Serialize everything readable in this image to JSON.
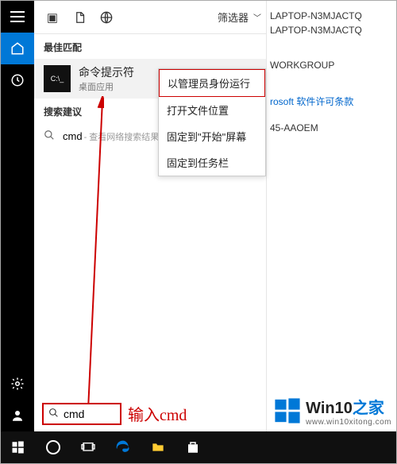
{
  "rail": {
    "items": [
      "menu",
      "home",
      "clock",
      "gear",
      "people"
    ]
  },
  "panel_top": {
    "filter_label": "筛选器"
  },
  "sections": {
    "best_match": "最佳匹配",
    "suggestions": "搜索建议"
  },
  "result": {
    "title": "命令提示符",
    "subtitle": "桌面应用",
    "thumb_text": "C:\\_"
  },
  "suggest": {
    "query": "cmd",
    "hint": "- 查看网络搜索结果"
  },
  "context_menu": {
    "items": [
      "以管理员身份运行",
      "打开文件位置",
      "固定到\"开始\"屏幕",
      "固定到任务栏"
    ],
    "highlight_index": 0
  },
  "background": {
    "line1": "LAPTOP-N3MJACTQ",
    "line2": "LAPTOP-N3MJACTQ",
    "line3": "WORKGROUP",
    "link": "rosoft 软件许可条款",
    "line4": "45-AAOEM"
  },
  "search": {
    "value": "cmd",
    "annotation": "输入cmd"
  },
  "watermark": {
    "brand1": "Win10",
    "brand2": "之家",
    "url": "www.win10xitong.com"
  },
  "taskbar_icons": [
    "start",
    "cortana",
    "taskview",
    "edge",
    "folder",
    "store"
  ]
}
